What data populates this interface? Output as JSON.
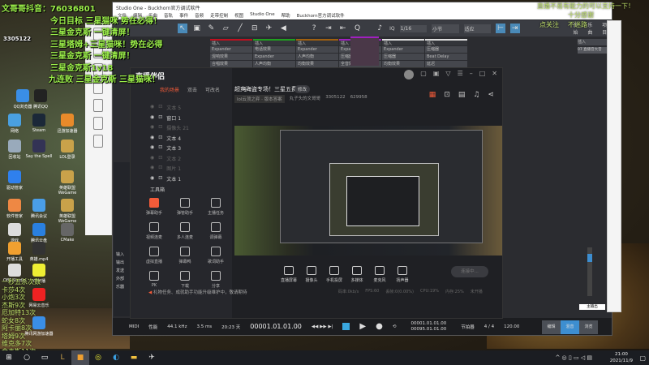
{
  "desktop": {
    "icons": [
      {
        "label": "QQ浏览器",
        "color": "#3a8ee6"
      },
      {
        "label": "腾讯QQ",
        "color": "#222"
      },
      {
        "label": "网络",
        "color": "#4aa0e0"
      },
      {
        "label": "Steam",
        "color": "#1b2838"
      },
      {
        "label": "迅游加速器",
        "color": "#e88a2a"
      },
      {
        "label": "回收站",
        "color": "#9ab"
      },
      {
        "label": "Say the Spell",
        "color": "#335"
      },
      {
        "label": "LOL登录",
        "color": "#c9a24a"
      },
      {
        "label": "驱动管家",
        "color": "#2f80ed"
      },
      {
        "label": "英雄联盟WeGame",
        "color": "#c9a24a"
      },
      {
        "label": "软件管家",
        "color": "#e84"
      },
      {
        "label": "腾讯会议",
        "color": "#4a9ee8"
      },
      {
        "label": "英雄联盟WeGame",
        "color": "#c9a24a"
      },
      {
        "label": "游戏",
        "color": "#ddd"
      },
      {
        "label": "腾讯云盘",
        "color": "#2a80e0"
      },
      {
        "label": "CMake",
        "color": "#666"
      },
      {
        "label": "开播工具",
        "color": "#f0a030"
      },
      {
        "label": "英雄.mp4",
        "color": "#333"
      },
      {
        "label": "OBS Studio",
        "color": "#ddd"
      },
      {
        "label": "YY开播",
        "color": "#ee3"
      },
      {
        "label": "网易云音乐",
        "color": "#e22"
      },
      {
        "label": "腾讯网游加速器",
        "color": "#3a8ee6"
      }
    ]
  },
  "overlay": {
    "chat": [
      "文哥哥抖音：76036801",
      "今日目标 三星猫咪 势在必得！",
      "三星金克斯 一键清屏！",
      "三星塔姆+三星猫咪！势在必得",
      "三星金克斯 一键清屏！",
      "三星金克斯1v18",
      "九连败 三星金克斯 三星猫咪！"
    ],
    "fans": "3305122",
    "counts": [
      "一秒五杀次数",
      "卡莎4次",
      "小炮3次",
      "杰斯9次",
      "厄加特13次",
      "蛇女8次",
      "阿卡丽8次",
      "塔姆9次",
      "维克多7次",
      "金克斯11次"
    ],
    "top_right": [
      "直播不易有能力的可以支持一下！",
      "十分感谢",
      "点关注",
      "不迷路"
    ]
  },
  "studio_one": {
    "title": "Studio One - Buckhorn官方调试软件",
    "menu": [
      "文件",
      "编辑",
      "乐曲",
      "音轨",
      "事件",
      "音频",
      "走带控制",
      "视图",
      "Studio One",
      "帮助",
      "Buckhorn官方调试软件"
    ],
    "toolbar": {
      "quantize": "1/16",
      "timebase": "小节",
      "snap": "适应",
      "q_label": "IQ",
      "labels": [
        "量化",
        "时基",
        "吸附"
      ],
      "right": [
        "开始",
        "乐曲",
        "项目"
      ]
    },
    "inserts": [
      "插入",
      "插入",
      "插入",
      "插入",
      "插入",
      "插入",
      "Expander",
      "电话效果",
      "Expander",
      "Expander",
      "Expander",
      "压缩器",
      "混响效果",
      "Expander",
      "人声均衡",
      "压缩器",
      "压缩器",
      "Beat Delay",
      "合唱效果",
      "人声均衡",
      "均衡效果",
      "全音效果",
      "均衡效果",
      "延迟"
    ],
    "right_insert": "插入",
    "right_insert_item": "07 直播音大音",
    "channels": [
      {
        "name": "麦克",
        "color": "#1a2ad0"
      },
      {
        "name": "伴奏",
        "color": "#e01020"
      },
      {
        "name": "音乐",
        "color": "#20b020"
      },
      {
        "name": "变声",
        "color": "#a05a10"
      },
      {
        "name": "电话音",
        "color": "#e020e0"
      },
      {
        "name": "回响",
        "color": "#ffffff"
      },
      {
        "name": "FX 1",
        "color": "#ffffff"
      },
      {
        "name": "录音",
        "color": "#a010e0"
      }
    ],
    "auto_label": "Auto: Off",
    "main_channel": "主输出",
    "side_labels": [
      "输入",
      "输出",
      "发送",
      "外部",
      "乐器"
    ],
    "transport": {
      "midi": "MIDI",
      "perf": "性能",
      "rate": "44.1 kHz",
      "latency": "3.5 ms",
      "time_left": "20:23 天",
      "rec_max": "录制最大长度",
      "position": "00001.01.01.00",
      "pos_unit": "小节",
      "loop_l": "00001.01.01.00",
      "loop_r": "00095.01.01.00",
      "metronome": "节拍器",
      "sig": "4 / 4",
      "sig_label": "拍号",
      "tempo": "120.00",
      "tempo_label": "速度"
    },
    "views": [
      "编辑",
      "混音",
      "浏览"
    ]
  },
  "zhibo": {
    "title": "直播伴侣",
    "tabs": [
      "我的场景",
      "双击",
      "可改名"
    ],
    "stream_title": "超爽海盗专场！三星五费",
    "edit": "修改",
    "category": "lol云顶之弈 · 版本答案",
    "username": "丸子头的文哥哥",
    "uid": "3305122",
    "heat": "629958",
    "layers": [
      {
        "name": "文本 5",
        "vis": false
      },
      {
        "name": "窗口 1",
        "vis": true
      },
      {
        "name": "摄像头 21",
        "vis": false
      },
      {
        "name": "文本 4",
        "vis": true
      },
      {
        "name": "文本 3",
        "vis": true
      },
      {
        "name": "文本 2",
        "vis": false
      },
      {
        "name": "图片 1",
        "vis": false
      },
      {
        "name": "文本 1",
        "vis": true
      }
    ],
    "toolbox": "工具箱",
    "tools": [
      "弹幕助手",
      "弹管助手",
      "主播任务",
      "视频连麦",
      "多人连麦",
      "调弹幕",
      "虚拟直播",
      "弹幕鸭",
      "歌词助手",
      "PK",
      "下载",
      "分享"
    ],
    "controls": [
      "直播屏幕",
      "摄像头",
      "手机投屏",
      "多媒体",
      "麦克风",
      "扬声器"
    ],
    "start": "连接中...",
    "notice": "礼物任务、成就助手功能升级维护中，敬请期待",
    "stats": [
      "码率:0kb/s",
      "FPS:60",
      "丢帧:0(0.00%)",
      "CPU:19%",
      "内存:25%",
      "未开播"
    ],
    "accent": "#f45b39"
  },
  "taskbar": {
    "time": "21:00",
    "date": "2021/11/9"
  }
}
